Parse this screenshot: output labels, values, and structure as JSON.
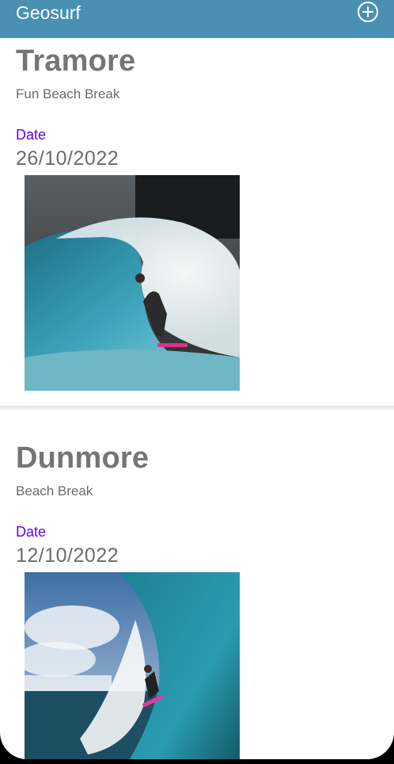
{
  "appbar": {
    "title": "Geosurf",
    "add_icon": "add-circle-icon",
    "color": "#4a90b2"
  },
  "spots": [
    {
      "name": "Tramore",
      "description": "Fun Beach Break",
      "date_label": "Date",
      "date": "26/10/2022"
    },
    {
      "name": "Dunmore",
      "description": "Beach Break",
      "date_label": "Date",
      "date": "12/10/2022"
    }
  ],
  "accent": "#6200ee"
}
